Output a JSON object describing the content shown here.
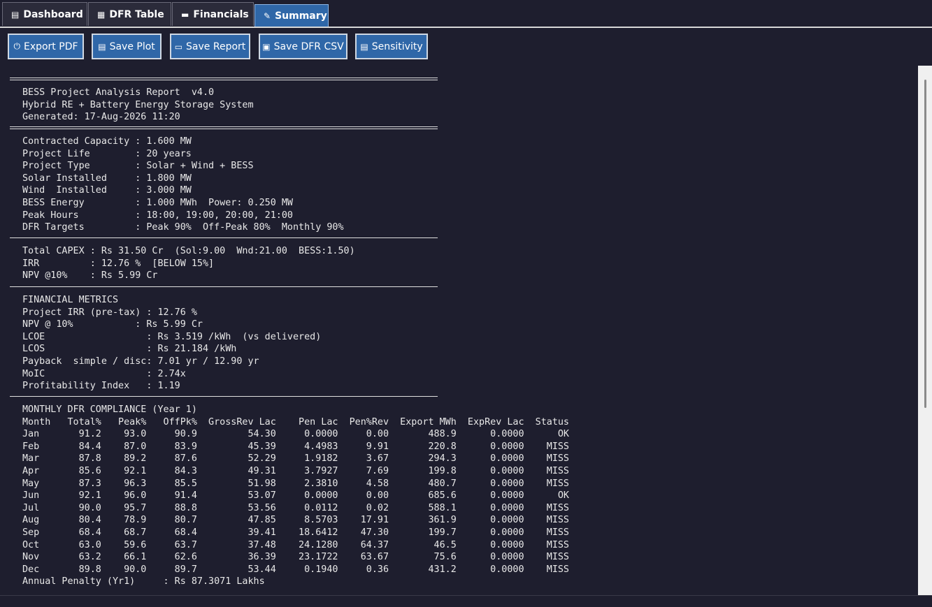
{
  "tabs": [
    {
      "label": "Dashboard",
      "icon": "chart-icon"
    },
    {
      "label": "DFR Table",
      "icon": "table-icon"
    },
    {
      "label": "Financials",
      "icon": "money-icon"
    },
    {
      "label": "Summary",
      "icon": "report-icon"
    }
  ],
  "toolbar": {
    "export_pdf": "Export PDF",
    "save_plot": "Save Plot",
    "save_report": "Save Report",
    "save_dfr_csv": "Save DFR CSV",
    "sensitivity": "Sensitivity"
  },
  "report": {
    "header": [
      "BESS Project Analysis Report  v4.0",
      "Hybrid RE + Battery Energy Storage System",
      "Generated: 17-Aug-2026 11:20"
    ],
    "config": [
      "Contracted Capacity : 1.600 MW",
      "Project Life        : 20 years",
      "Project Type        : Solar + Wind + BESS",
      "Solar Installed     : 1.800 MW",
      "Wind  Installed     : 3.000 MW",
      "BESS Energy         : 1.000 MWh  Power: 0.250 MW",
      "Peak Hours          : 18:00, 19:00, 20:00, 21:00",
      "DFR Targets         : Peak 90%  Off-Peak 80%  Monthly 90%"
    ],
    "summary": [
      "Total CAPEX : Rs 31.50 Cr  (Sol:9.00  Wnd:21.00  BESS:1.50)",
      "IRR         : 12.76 %  [BELOW 15%]",
      "NPV @10%    : Rs 5.99 Cr"
    ],
    "financial": [
      "FINANCIAL METRICS",
      "Project IRR (pre-tax) : 12.76 %",
      "NPV @ 10%           : Rs 5.99 Cr",
      "LCOE                  : Rs 3.519 /kWh  (vs delivered)",
      "LCOS                  : Rs 21.184 /kWh",
      "Payback  simple / disc: 7.01 yr / 12.90 yr",
      "MoIC                  : 2.74x",
      "Profitability Index   : 1.19"
    ],
    "monthly": [
      "MONTHLY DFR COMPLIANCE (Year 1)",
      "Month   Total%   Peak%   OffPk%  GrossRev Lac    Pen Lac  Pen%Rev  Export MWh  ExpRev Lac  Status",
      "Jan       91.2    93.0     90.9         54.30     0.0000     0.00       488.9      0.0000      OK",
      "Feb       84.4    87.0     83.9         45.39     4.4983     9.91       220.8      0.0000    MISS",
      "Mar       87.8    89.2     87.6         52.29     1.9182     3.67       294.3      0.0000    MISS",
      "Apr       85.6    92.1     84.3         49.31     3.7927     7.69       199.8      0.0000    MISS",
      "May       87.3    96.3     85.5         51.98     2.3810     4.58       480.7      0.0000    MISS",
      "Jun       92.1    96.0     91.4         53.07     0.0000     0.00       685.6      0.0000      OK",
      "Jul       90.0    95.7     88.8         53.56     0.0112     0.02       588.1      0.0000    MISS",
      "Aug       80.4    78.9     80.7         47.85     8.5703    17.91       361.9      0.0000    MISS",
      "Sep       68.4    68.7     68.4         39.41    18.6412    47.30       199.7      0.0000    MISS",
      "Oct       63.0    59.6     63.7         37.48    24.1280    64.37        46.5      0.0000    MISS",
      "Nov       63.2    66.1     62.6         36.39    23.1722    63.67        75.6      0.0000    MISS",
      "Dec       89.8    90.0     89.7         53.44     0.1940     0.36       431.2      0.0000    MISS",
      "Annual Penalty (Yr1)     : Rs 87.3071 Lakhs"
    ]
  }
}
